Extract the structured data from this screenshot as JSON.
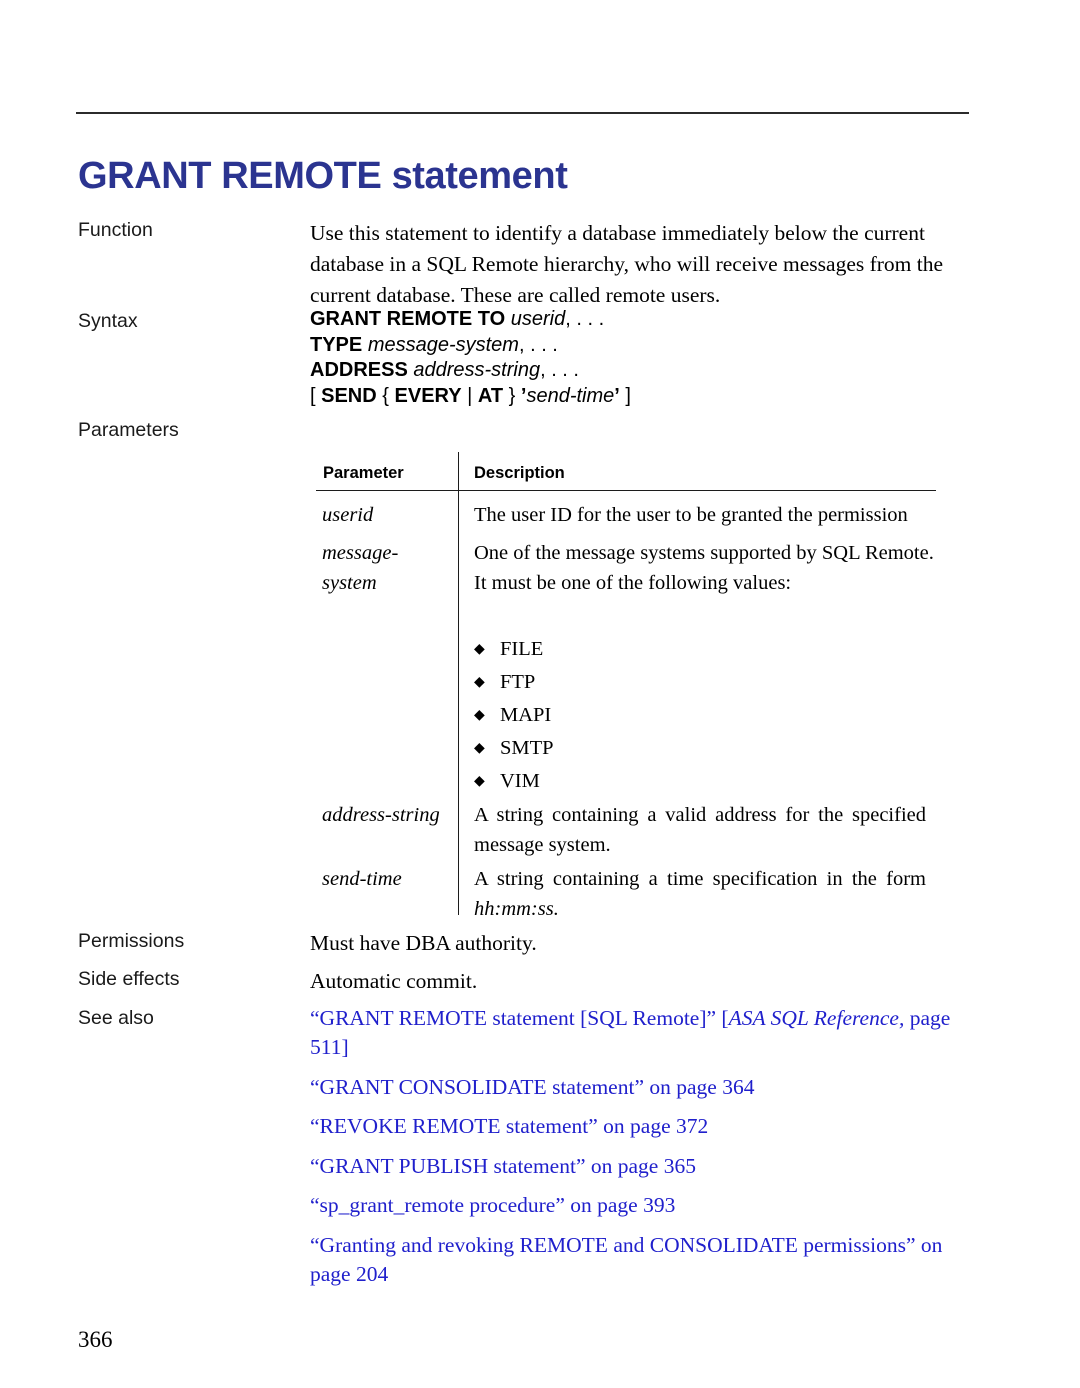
{
  "page": {
    "title": "GRANT REMOTE statement",
    "page_number": "366",
    "title_color": "#2b3490",
    "link_color": "#2020cc"
  },
  "sections": {
    "function": {
      "label": "Function",
      "text": "Use this statement to identify a database immediately below the current database in a SQL Remote hierarchy, who will receive messages from the current database. These are called remote users."
    },
    "syntax": {
      "label": "Syntax",
      "lines": [
        {
          "keyword": "GRANT REMOTE TO",
          "placeholder": "userid",
          "trailing": ", . . ."
        },
        {
          "keyword": "TYPE",
          "placeholder": "message-system",
          "trailing": ", . . ."
        },
        {
          "keyword": "ADDRESS",
          "placeholder": "address-string",
          "trailing": ", . . ."
        },
        {
          "open": "[ ",
          "keyword": "SEND",
          "brace_open": "{",
          "keyword2": "EVERY",
          "pipe": "|",
          "keyword3": "AT",
          "brace_close": "}",
          "quote_open": "’",
          "placeholder": "send-time",
          "quote_close": "’",
          "close": " ]"
        }
      ]
    },
    "parameters": {
      "label": "Parameters",
      "columns": [
        "Parameter",
        "Description"
      ],
      "rows": [
        {
          "name": "userid",
          "description": "The user ID for the user to be granted the permission",
          "justify": false
        },
        {
          "name": "message-\nsystem",
          "name_line1": "message-",
          "name_line2": "system",
          "description": "One of the message systems supported by SQL Remote. It must be one of the following values:",
          "justify": false,
          "bullets": [
            "FILE",
            "FTP",
            "MAPI",
            "SMTP",
            "VIM"
          ]
        },
        {
          "name": "address-string",
          "description": "A string containing a valid address for the specified message system.",
          "justify": true
        },
        {
          "name": "send-time",
          "description_pre": "A string containing a time specification in the form ",
          "description_italic": "hh:mm:ss.",
          "justify": true
        }
      ]
    },
    "permissions": {
      "label": "Permissions",
      "text": "Must have DBA authority."
    },
    "side_effects": {
      "label": "Side effects",
      "text": "Automatic commit."
    },
    "see_also": {
      "label": "See also",
      "links": [
        {
          "text_pre": "“GRANT REMOTE statement [SQL Remote]” [",
          "text_italic": "ASA SQL Reference,",
          "text_post": " page 511]"
        },
        {
          "text_pre": "“GRANT CONSOLIDATE statement” on page 364"
        },
        {
          "text_pre": "“REVOKE REMOTE statement” on page 372"
        },
        {
          "text_pre": "“GRANT PUBLISH statement” on page 365"
        },
        {
          "text_pre": "“sp_grant_remote procedure” on page 393"
        },
        {
          "text_pre": "“Granting and revoking REMOTE and CONSOLIDATE permissions” on page 204"
        }
      ]
    }
  }
}
